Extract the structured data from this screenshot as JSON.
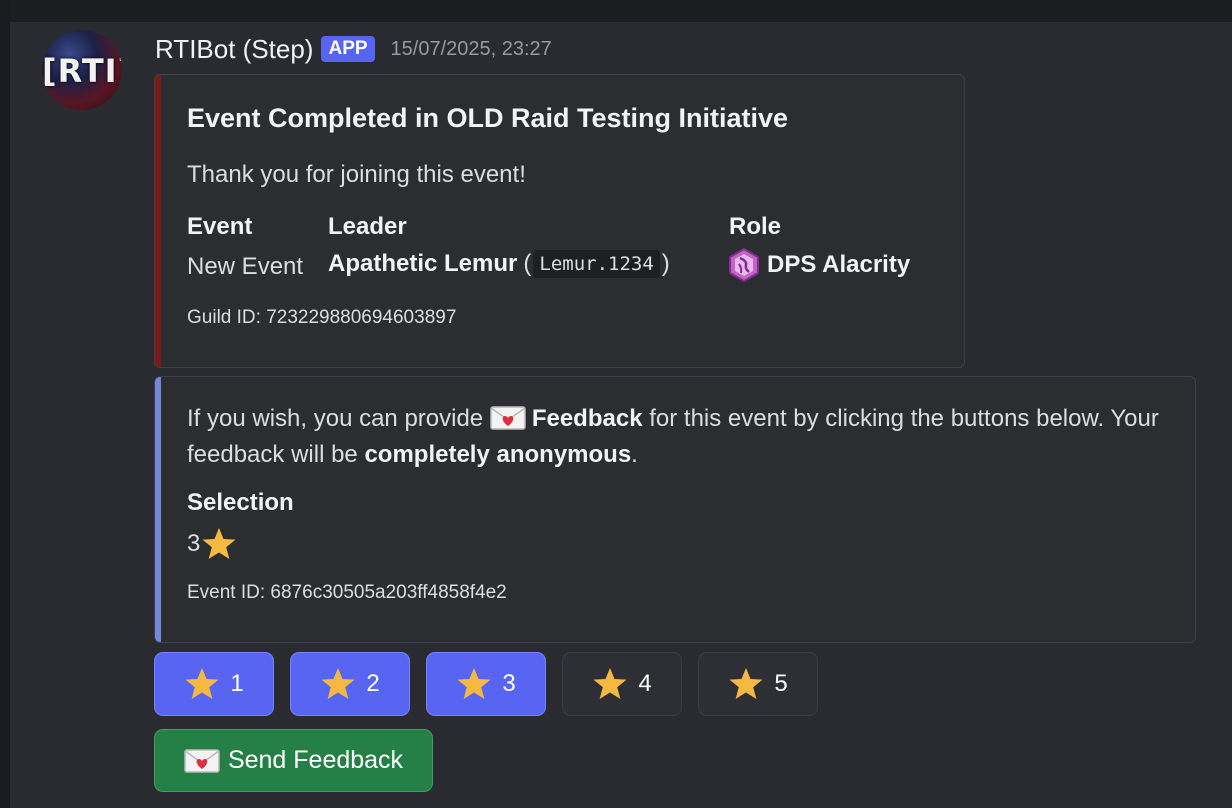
{
  "message": {
    "author": "RTIBot (Step)",
    "badge": "APP",
    "timestamp": "15/07/2025, 23:27",
    "avatar_text": "[RTI]"
  },
  "embed_completed": {
    "accent_color": "#7a1a1c",
    "title": "Event Completed in OLD Raid Testing Initiative",
    "description": "Thank you for joining this event!",
    "fields": {
      "event": {
        "name": "Event",
        "value": "New Event"
      },
      "leader": {
        "name": "Leader",
        "value_bold": "Apathetic Lemur",
        "open": "(",
        "code": "Lemur.1234",
        "close": ")"
      },
      "role": {
        "name": "Role",
        "value": "DPS Alacrity",
        "icon": "alacrity-role-icon"
      }
    },
    "footer": "Guild ID: 723229880694603897"
  },
  "embed_feedback": {
    "accent_color": "#7289da",
    "desc_part1": "If you wish, you can provide",
    "desc_bold1": "Feedback",
    "desc_part2": "for this event by clicking the buttons below. Your feedback will be",
    "desc_bold2": "completely anonymous",
    "desc_end": ".",
    "field_name": "Selection",
    "field_value": "3",
    "footer": "Event ID: 6876c30505a203ff4858f4e2"
  },
  "rating_buttons": [
    {
      "label": "1",
      "active": true
    },
    {
      "label": "2",
      "active": true
    },
    {
      "label": "3",
      "active": true
    },
    {
      "label": "4",
      "active": false
    },
    {
      "label": "5",
      "active": false
    }
  ],
  "send_button": {
    "label": "Send Feedback",
    "color": "#248046"
  },
  "colors": {
    "blurple": "#5865f2",
    "star": "#f5b942",
    "green": "#248046"
  }
}
